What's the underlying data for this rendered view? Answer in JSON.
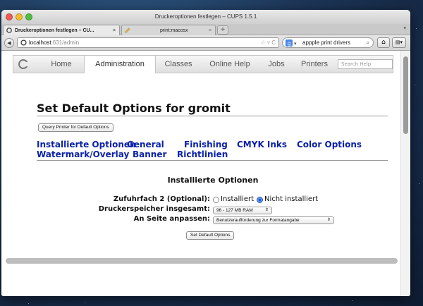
{
  "window": {
    "title": "Druckeroptionen festlegen – CUPS 1.5.1"
  },
  "tabs": [
    {
      "label": "Druckeroptionen festlegen – CU...",
      "active": true
    },
    {
      "label": "print:macosx",
      "active": false
    }
  ],
  "toolbar": {
    "url_host": "localhost",
    "url_rest": ":631/admin",
    "search_value": "appple print drivers"
  },
  "cups_nav": {
    "items": [
      "Home",
      "Administration",
      "Classes",
      "Online Help",
      "Jobs",
      "Printers"
    ],
    "selected": "Administration",
    "search_placeholder": "Search Help"
  },
  "page": {
    "title": "Set Default Options for gromit",
    "query_button": "Query Printer for Default Options",
    "option_links": [
      "Installierte Optionen",
      "General",
      "Finishing",
      "CMYK Inks",
      "Color Options",
      "Watermark/Overlay",
      "Banner",
      "Richtlinien"
    ],
    "section_title": "Installierte Optionen",
    "options": {
      "tray_label": "Zufuhrfach 2 (Optional):",
      "tray_choices": [
        "Installiert",
        "Nicht installiert"
      ],
      "tray_selected": "Nicht installiert",
      "memory_label": "Druckerspeicher insgesamt:",
      "memory_value": "96 - 127 MB RAM",
      "fit_label": "An Seite anpassen:",
      "fit_value": "Benutzeraufforderung zur Formatangabe"
    },
    "submit_button": "Set Default Options"
  },
  "colors": {
    "link": "#0b22a8",
    "radio_on": "#3a77e0"
  }
}
